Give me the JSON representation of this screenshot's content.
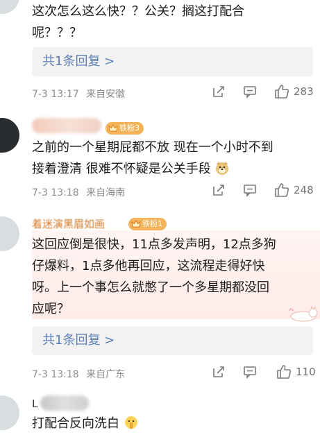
{
  "comments": [
    {
      "text_lines": [
        "这次怎么这么快？？公关？搁这打配合",
        "呢？？？"
      ],
      "replies_label": "共1条回复 >",
      "time": "7-3 13:17",
      "location": "来自安徽",
      "likes": "283"
    },
    {
      "badge": "铁粉3",
      "text_lines": [
        "之前的一个星期屁都不放 现在一个小时不到",
        "接着澄清 很难不怀疑是公关手段"
      ],
      "emoji": "doge-emoji",
      "time": "7-3 13:18",
      "location": "来自海南",
      "likes": "248"
    },
    {
      "name_partial": "着迷演黑眉如画",
      "badge": "铁粉1",
      "text_lines": [
        "这回应倒是很快，11点多发声明，12点多狗",
        "仔爆料，1点多他再回应，这流程走得好快",
        "呀。上一个事怎么就憋了一个多星期都没回",
        "应呢？"
      ],
      "replies_label": "共1条回复 >",
      "time": "7-3 13:18",
      "location": "来自广东",
      "likes": "110"
    },
    {
      "name_partial": "L",
      "text_lines": [
        "打配合反向洗白"
      ],
      "emoji": "shush-emoji"
    }
  ]
}
